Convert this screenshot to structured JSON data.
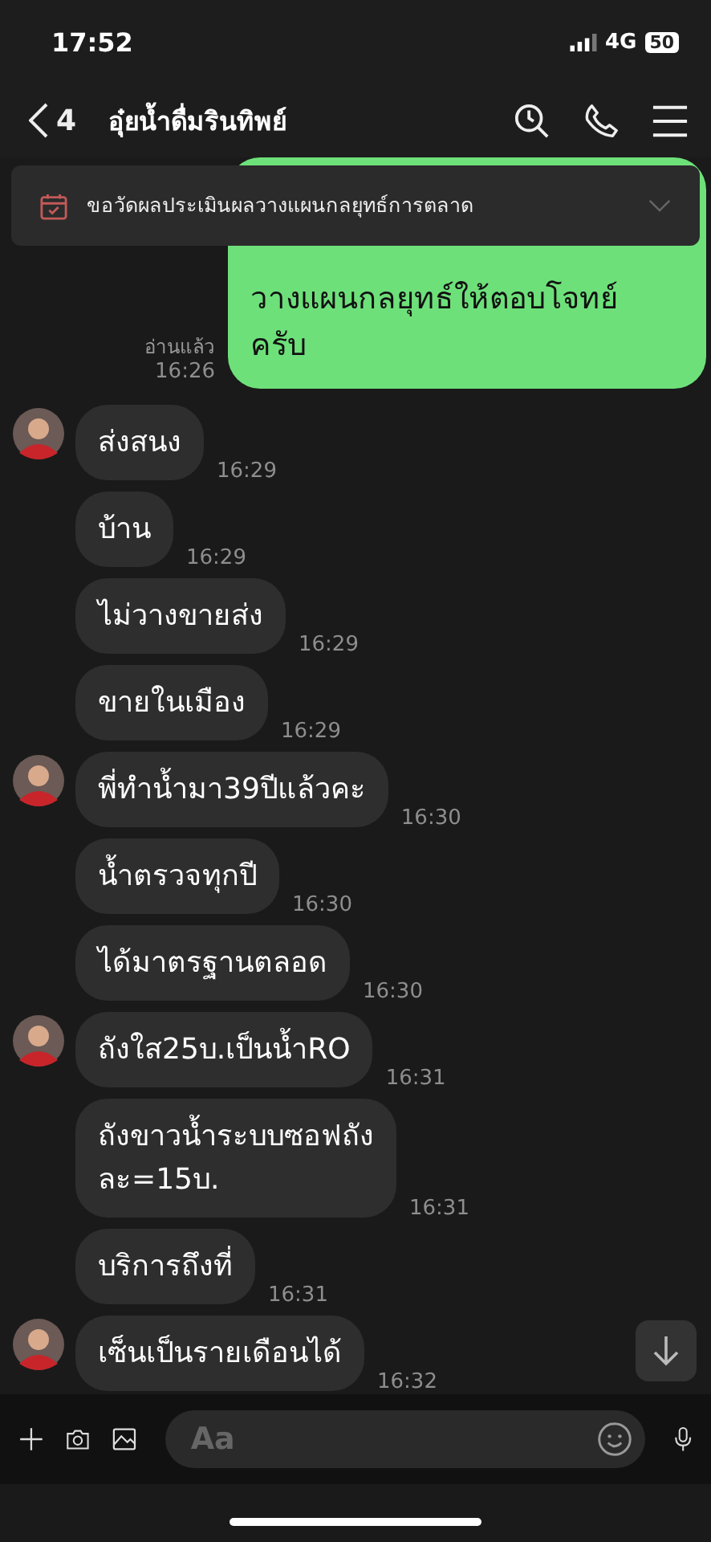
{
  "status_bar": {
    "time": "17:52",
    "network": "4G",
    "battery": "50"
  },
  "header": {
    "back_count": "4",
    "title": "อุ๋ยน้ำดื่มรินทิพย์"
  },
  "pinned_note": {
    "text": "ขอวัดผลประเมินผลวางแผนกลยุทธ์การตลาด",
    "expanded": false
  },
  "messages": [
    {
      "kind": "sent",
      "text": "วางแผนกลยุทธ์ให้ตอบโจทย์\nครับ",
      "read_label": "อ่านแล้ว",
      "time": "16:26"
    },
    {
      "kind": "received",
      "avatar": true,
      "text": "ส่งสนง",
      "time": "16:29"
    },
    {
      "kind": "received",
      "avatar": false,
      "text": "บ้าน",
      "time": "16:29"
    },
    {
      "kind": "received",
      "avatar": false,
      "text": "ไม่วางขายส่ง",
      "time": "16:29"
    },
    {
      "kind": "received",
      "avatar": false,
      "text": "ขายในเมือง",
      "time": "16:29"
    },
    {
      "kind": "received",
      "avatar": true,
      "text": "พี่ทำน้ำมา39ปีแล้วคะ",
      "time": "16:30"
    },
    {
      "kind": "received",
      "avatar": false,
      "text": "น้ำตรวจทุกปี",
      "time": "16:30"
    },
    {
      "kind": "received",
      "avatar": false,
      "text": "ได้มาตรฐานตลอด",
      "time": "16:30"
    },
    {
      "kind": "received",
      "avatar": true,
      "text": "ถังใส25บ.เป็นน้ำRO",
      "time": "16:31"
    },
    {
      "kind": "received",
      "avatar": false,
      "text": "ถังขาวน้ำระบบซอฟถัง\nละ=15บ.",
      "time": "16:31"
    },
    {
      "kind": "received",
      "avatar": false,
      "text": "บริการถึงที่",
      "time": "16:31"
    },
    {
      "kind": "received",
      "avatar": true,
      "text": "เซ็นเป็นรายเดือนได้",
      "time": "16:32"
    }
  ],
  "composer": {
    "placeholder": "Aa"
  }
}
